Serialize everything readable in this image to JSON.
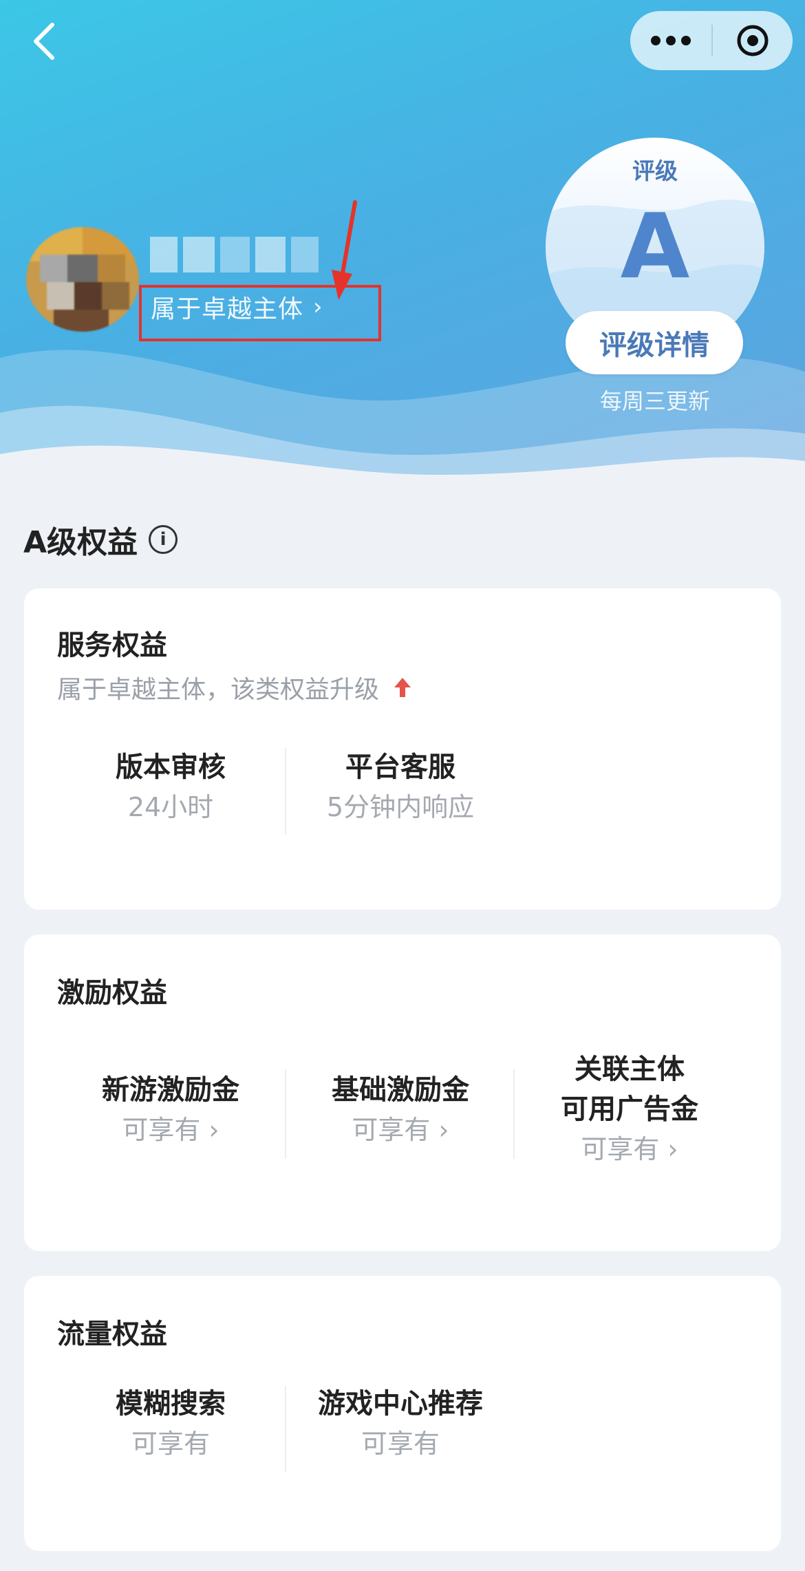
{
  "top_bar": {
    "back_icon": "chevron-left-icon",
    "more_icon": "more-dots-icon",
    "target_icon": "target-icon"
  },
  "profile": {
    "org_link_label": "属于卓越主体",
    "org_link_chevron": "›"
  },
  "rating": {
    "label": "评级",
    "value": "A",
    "detail_button": "评级详情",
    "update_note": "每周三更新"
  },
  "benefits_section": {
    "title": "A级权益",
    "info_icon_glyph": "i"
  },
  "service_card": {
    "title": "服务权益",
    "subtitle": "属于卓越主体，该类权益升级",
    "items": [
      {
        "name": "版本审核",
        "value": "24小时"
      },
      {
        "name": "平台客服",
        "value": "5分钟内响应"
      }
    ]
  },
  "incentive_card": {
    "title": "激励权益",
    "items": [
      {
        "name": "新游激励金",
        "value": "可享有",
        "chevron": "›"
      },
      {
        "name": "基础激励金",
        "value": "可享有",
        "chevron": "›"
      },
      {
        "name_line1": "关联主体",
        "name_line2": "可用广告金",
        "value": "可享有",
        "chevron": "›"
      }
    ]
  },
  "traffic_card": {
    "title": "流量权益",
    "items": [
      {
        "name": "模糊搜索",
        "value": "可享有"
      },
      {
        "name": "游戏中心推荐",
        "value": "可享有"
      }
    ]
  },
  "colors": {
    "header_gradient_start": "#3cc7e6",
    "header_gradient_end": "#5fa3e0",
    "rating_text": "#4a79b8",
    "annotation_red": "#e5332a",
    "page_background": "#eef2f7"
  }
}
